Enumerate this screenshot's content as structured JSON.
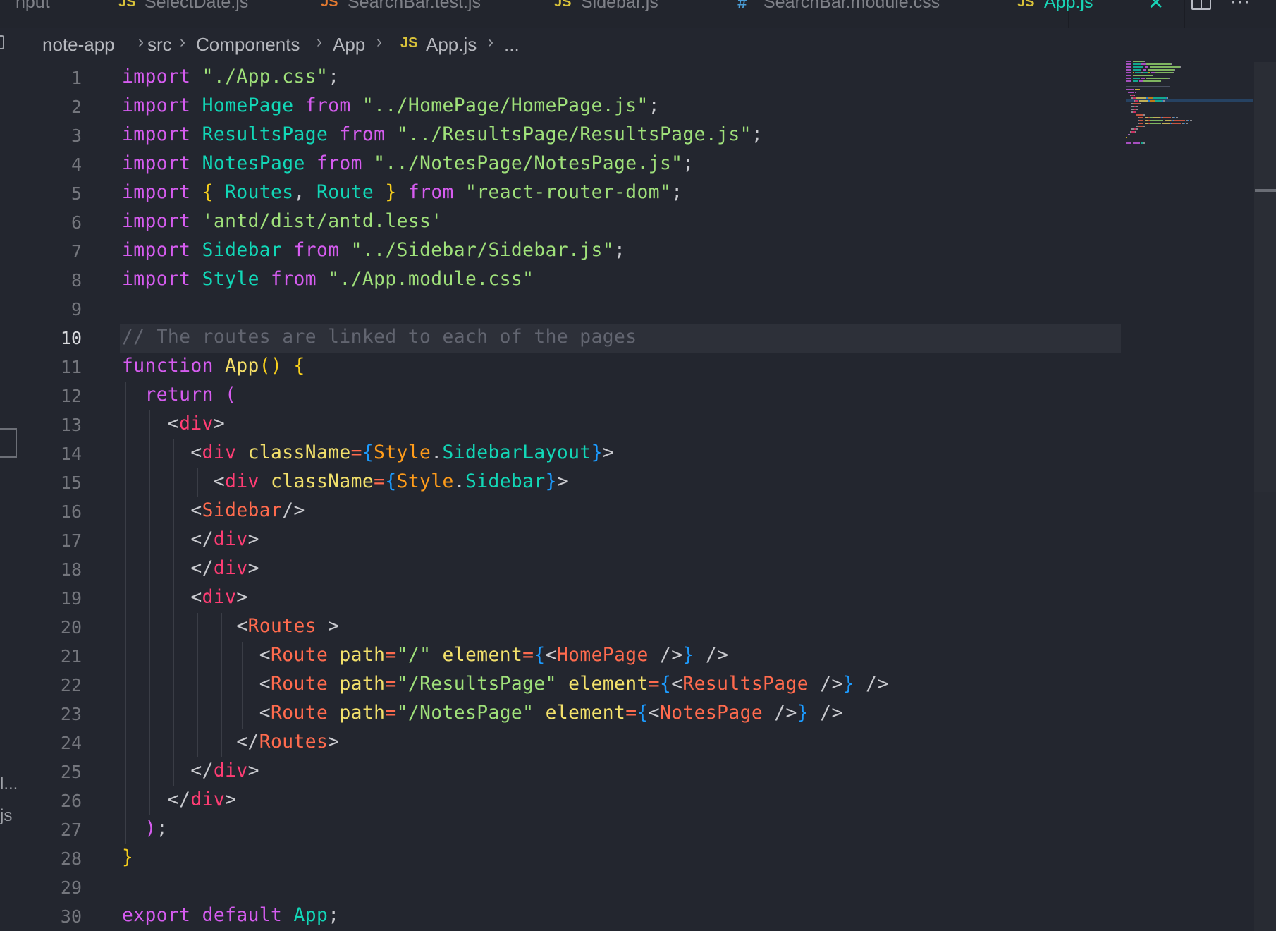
{
  "tabs": [
    {
      "label": "nput",
      "icon": "none",
      "active": false
    },
    {
      "label": "SelectDate.js",
      "icon": "JS",
      "icon_type": "js",
      "active": false
    },
    {
      "label": "SearchBar.test.js",
      "icon": "JS",
      "icon_type": "test",
      "active": false
    },
    {
      "label": "Sidebar.js",
      "icon": "JS",
      "icon_type": "js",
      "active": false
    },
    {
      "label": "SearchBar.module.css",
      "icon": "#",
      "icon_type": "css",
      "active": false
    },
    {
      "label": "App.js",
      "icon": "JS",
      "icon_type": "js",
      "active": true
    }
  ],
  "tab_actions": {
    "close": "✕",
    "split": "split-editor",
    "more": "···"
  },
  "breadcrumb": {
    "items": [
      "note-app",
      "src",
      "Components",
      "App",
      "App.js",
      "..."
    ],
    "file_icon": "JS",
    "separator": "›"
  },
  "editor": {
    "current_line": 10,
    "lines": [
      {
        "n": "1"
      },
      {
        "n": "2"
      },
      {
        "n": "3"
      },
      {
        "n": "4"
      },
      {
        "n": "5"
      },
      {
        "n": "6"
      },
      {
        "n": "7"
      },
      {
        "n": "8"
      },
      {
        "n": "9"
      },
      {
        "n": "10"
      },
      {
        "n": "11"
      },
      {
        "n": "12"
      },
      {
        "n": "13"
      },
      {
        "n": "14"
      },
      {
        "n": "15"
      },
      {
        "n": "16"
      },
      {
        "n": "17"
      },
      {
        "n": "18"
      },
      {
        "n": "19"
      },
      {
        "n": "20"
      },
      {
        "n": "21"
      },
      {
        "n": "22"
      },
      {
        "n": "23"
      },
      {
        "n": "24"
      },
      {
        "n": "25"
      },
      {
        "n": "26"
      },
      {
        "n": "27"
      },
      {
        "n": "28"
      },
      {
        "n": "29"
      },
      {
        "n": "30"
      }
    ],
    "tokens": [
      [
        [
          "kw",
          "import"
        ],
        [
          "punc",
          " "
        ],
        [
          "str",
          "\"./App.css\""
        ],
        [
          "punc",
          ";"
        ]
      ],
      [
        [
          "kw",
          "import"
        ],
        [
          "punc",
          " "
        ],
        [
          "id",
          "HomePage"
        ],
        [
          "punc",
          " "
        ],
        [
          "kw",
          "from"
        ],
        [
          "punc",
          " "
        ],
        [
          "str",
          "\"../HomePage/HomePage.js\""
        ],
        [
          "punc",
          ";"
        ]
      ],
      [
        [
          "kw",
          "import"
        ],
        [
          "punc",
          " "
        ],
        [
          "id",
          "ResultsPage"
        ],
        [
          "punc",
          " "
        ],
        [
          "kw",
          "from"
        ],
        [
          "punc",
          " "
        ],
        [
          "str",
          "\"../ResultsPage/ResultsPage.js\""
        ],
        [
          "punc",
          ";"
        ]
      ],
      [
        [
          "kw",
          "import"
        ],
        [
          "punc",
          " "
        ],
        [
          "id",
          "NotesPage"
        ],
        [
          "punc",
          " "
        ],
        [
          "kw",
          "from"
        ],
        [
          "punc",
          " "
        ],
        [
          "str",
          "\"../NotesPage/NotesPage.js\""
        ],
        [
          "punc",
          ";"
        ]
      ],
      [
        [
          "kw",
          "import"
        ],
        [
          "punc",
          " "
        ],
        [
          "br1",
          "{"
        ],
        [
          "punc",
          " "
        ],
        [
          "id",
          "Routes"
        ],
        [
          "punc",
          ", "
        ],
        [
          "id",
          "Route"
        ],
        [
          "punc",
          " "
        ],
        [
          "br1",
          "}"
        ],
        [
          "punc",
          " "
        ],
        [
          "kw",
          "from"
        ],
        [
          "punc",
          " "
        ],
        [
          "str",
          "\"react-router-dom\""
        ],
        [
          "punc",
          ";"
        ]
      ],
      [
        [
          "kw",
          "import"
        ],
        [
          "punc",
          " "
        ],
        [
          "str",
          "'antd/dist/antd.less'"
        ]
      ],
      [
        [
          "kw",
          "import"
        ],
        [
          "punc",
          " "
        ],
        [
          "id",
          "Sidebar"
        ],
        [
          "punc",
          " "
        ],
        [
          "kw",
          "from"
        ],
        [
          "punc",
          " "
        ],
        [
          "str",
          "\"../Sidebar/Sidebar.js\""
        ],
        [
          "punc",
          ";"
        ]
      ],
      [
        [
          "kw",
          "import"
        ],
        [
          "punc",
          " "
        ],
        [
          "id",
          "Style"
        ],
        [
          "punc",
          " "
        ],
        [
          "kw",
          "from"
        ],
        [
          "punc",
          " "
        ],
        [
          "str",
          "\"./App.module.css\""
        ]
      ],
      [],
      [
        [
          "cm",
          "// The routes are linked to each of the pages"
        ]
      ],
      [
        [
          "kw",
          "function"
        ],
        [
          "punc",
          " "
        ],
        [
          "fn",
          "App"
        ],
        [
          "br1",
          "()"
        ],
        [
          "punc",
          " "
        ],
        [
          "br1",
          "{"
        ]
      ],
      [
        [
          "punc",
          "  "
        ],
        [
          "kw",
          "return"
        ],
        [
          "punc",
          " "
        ],
        [
          "br2",
          "("
        ]
      ],
      [
        [
          "punc",
          "    <"
        ],
        [
          "tag",
          "div"
        ],
        [
          "punc",
          ">"
        ]
      ],
      [
        [
          "punc",
          "      <"
        ],
        [
          "tag",
          "div"
        ],
        [
          "punc",
          " "
        ],
        [
          "attr",
          "className"
        ],
        [
          "op",
          "="
        ],
        [
          "br3",
          "{"
        ],
        [
          "obj",
          "Style"
        ],
        [
          "punc",
          "."
        ],
        [
          "prop",
          "SidebarLayout"
        ],
        [
          "br3",
          "}"
        ],
        [
          "punc",
          ">"
        ]
      ],
      [
        [
          "punc",
          "        <"
        ],
        [
          "tag",
          "div"
        ],
        [
          "punc",
          " "
        ],
        [
          "attr",
          "className"
        ],
        [
          "op",
          "="
        ],
        [
          "br3",
          "{"
        ],
        [
          "obj",
          "Style"
        ],
        [
          "punc",
          "."
        ],
        [
          "prop",
          "Sidebar"
        ],
        [
          "br3",
          "}"
        ],
        [
          "punc",
          ">"
        ]
      ],
      [
        [
          "punc",
          "      <"
        ],
        [
          "comp",
          "Sidebar"
        ],
        [
          "punc",
          "/>"
        ]
      ],
      [
        [
          "punc",
          "      </"
        ],
        [
          "tag",
          "div"
        ],
        [
          "punc",
          ">"
        ]
      ],
      [
        [
          "punc",
          "      </"
        ],
        [
          "tag",
          "div"
        ],
        [
          "punc",
          ">"
        ]
      ],
      [
        [
          "punc",
          "      <"
        ],
        [
          "tag",
          "div"
        ],
        [
          "punc",
          ">"
        ]
      ],
      [
        [
          "punc",
          "          <"
        ],
        [
          "comp",
          "Routes"
        ],
        [
          "punc",
          " >"
        ]
      ],
      [
        [
          "punc",
          "            <"
        ],
        [
          "comp",
          "Route"
        ],
        [
          "punc",
          " "
        ],
        [
          "attr",
          "path"
        ],
        [
          "op",
          "="
        ],
        [
          "str",
          "\"/\""
        ],
        [
          "punc",
          " "
        ],
        [
          "attr",
          "element"
        ],
        [
          "op",
          "="
        ],
        [
          "br3",
          "{"
        ],
        [
          "punc",
          "<"
        ],
        [
          "comp",
          "HomePage"
        ],
        [
          "punc",
          " />"
        ],
        [
          "br3",
          "}"
        ],
        [
          "punc",
          " />"
        ]
      ],
      [
        [
          "punc",
          "            <"
        ],
        [
          "comp",
          "Route"
        ],
        [
          "punc",
          " "
        ],
        [
          "attr",
          "path"
        ],
        [
          "op",
          "="
        ],
        [
          "str",
          "\"/ResultsPage\""
        ],
        [
          "punc",
          " "
        ],
        [
          "attr",
          "element"
        ],
        [
          "op",
          "="
        ],
        [
          "br3",
          "{"
        ],
        [
          "punc",
          "<"
        ],
        [
          "comp",
          "ResultsPage"
        ],
        [
          "punc",
          " />"
        ],
        [
          "br3",
          "}"
        ],
        [
          "punc",
          " />"
        ]
      ],
      [
        [
          "punc",
          "            <"
        ],
        [
          "comp",
          "Route"
        ],
        [
          "punc",
          " "
        ],
        [
          "attr",
          "path"
        ],
        [
          "op",
          "="
        ],
        [
          "str",
          "\"/NotesPage\""
        ],
        [
          "punc",
          " "
        ],
        [
          "attr",
          "element"
        ],
        [
          "op",
          "="
        ],
        [
          "br3",
          "{"
        ],
        [
          "punc",
          "<"
        ],
        [
          "comp",
          "NotesPage"
        ],
        [
          "punc",
          " />"
        ],
        [
          "br3",
          "}"
        ],
        [
          "punc",
          " />"
        ]
      ],
      [
        [
          "punc",
          "          </"
        ],
        [
          "comp",
          "Routes"
        ],
        [
          "punc",
          ">"
        ]
      ],
      [
        [
          "punc",
          "      </"
        ],
        [
          "tag",
          "div"
        ],
        [
          "punc",
          ">"
        ]
      ],
      [
        [
          "punc",
          "    </"
        ],
        [
          "tag",
          "div"
        ],
        [
          "punc",
          ">"
        ]
      ],
      [
        [
          "punc",
          "  "
        ],
        [
          "br2",
          ")"
        ],
        [
          "punc",
          ";"
        ]
      ],
      [
        [
          "br1",
          "}"
        ]
      ],
      [],
      [
        [
          "kw",
          "export"
        ],
        [
          "punc",
          " "
        ],
        [
          "kw",
          "default"
        ],
        [
          "punc",
          " "
        ],
        [
          "id",
          "App"
        ],
        [
          "punc",
          ";"
        ]
      ]
    ]
  },
  "left_panel_fragments": [
    "l...",
    "js"
  ],
  "colors": {
    "background": "#23262f",
    "accent": "#19d5b7",
    "keyword": "#d65cf0",
    "string": "#9fe07a",
    "identifier": "#12d7b7",
    "comment": "#626570",
    "tag": "#ff3d74",
    "component": "#ff6b4e",
    "attribute": "#f2e06b"
  }
}
